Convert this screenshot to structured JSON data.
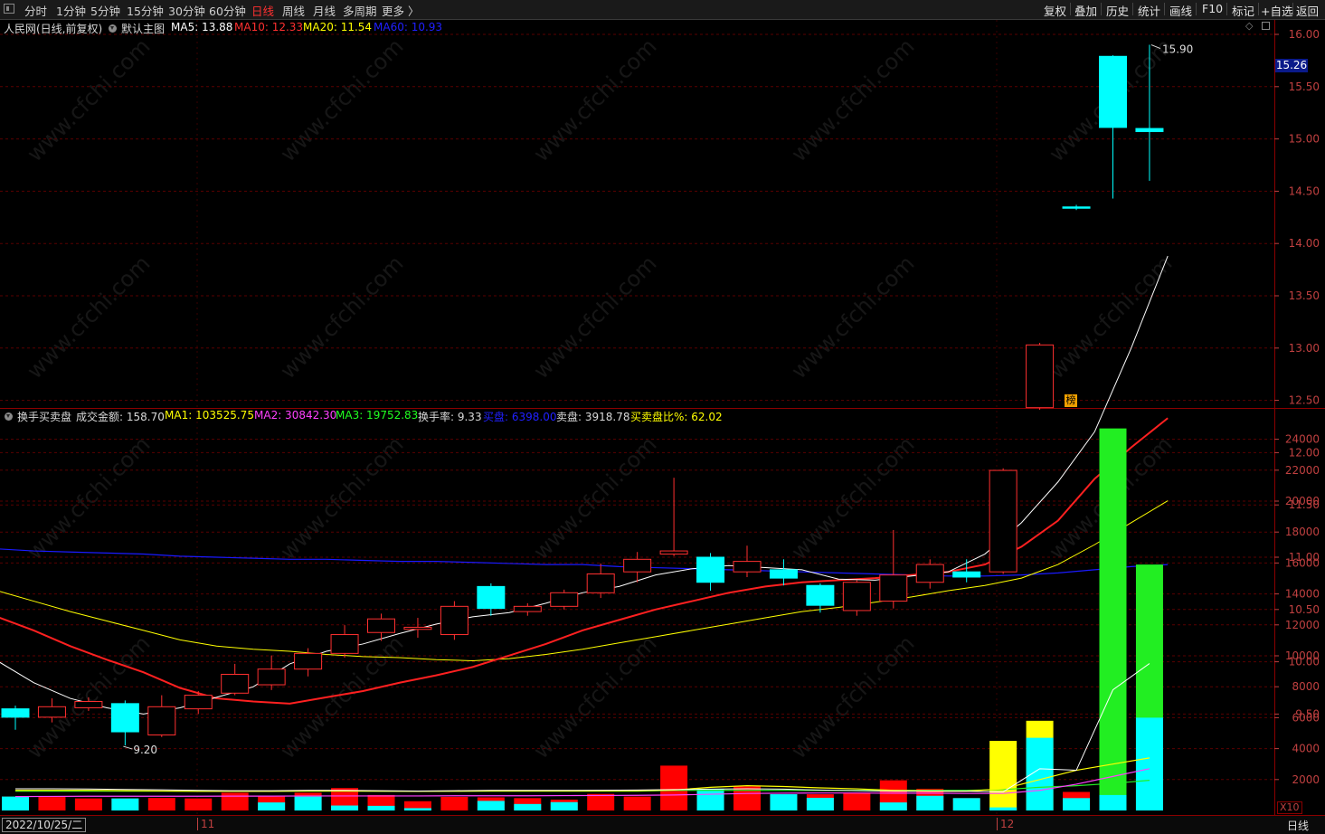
{
  "toolbar": {
    "periods": [
      "分时",
      "1分钟",
      "5分钟",
      "15分钟",
      "30分钟",
      "60分钟",
      "日线",
      "周线",
      "月线",
      "多周期",
      "更多 〉"
    ],
    "active_period": "日线",
    "right_buttons": [
      "复权",
      "叠加",
      "历史",
      "统计",
      "画线",
      "F10",
      "标记",
      "+自选",
      "返回"
    ]
  },
  "main_legend": {
    "title": "人民网(日线,前复权)",
    "indicator": "默认主图",
    "ma5": "MA5: 13.88",
    "ma10": "MA10: 12.33",
    "ma20": "MA20: 11.54",
    "ma60": "MA60: 10.93"
  },
  "sub_legend": {
    "title": "换手买卖盘",
    "amount": "成交金额: 158.70",
    "ma1": "MA1: 103525.75",
    "ma2": "MA2: 30842.30",
    "ma3": "MA3: 19752.83",
    "turnover": "换手率: 9.33",
    "buy": "买盘: 6398.00",
    "sell": "卖盘: 3918.78",
    "ratio": "买卖盘比%: 62.02"
  },
  "annotations": {
    "high": "15.90",
    "low": "9.20",
    "current_price": "15.26",
    "rank_badge": "榜",
    "volume_scale": "X10"
  },
  "bottom": {
    "start_date": "2022/10/25/二",
    "month_11": "11",
    "month_12": "12",
    "period_label": "日线"
  },
  "colors": {
    "up": "#ff3030",
    "down": "#00ffff",
    "ma5": "#ffffff",
    "ma10": "#ff2020",
    "ma20": "#ffff00",
    "ma60": "#1a1aff",
    "grid": "#5a0000",
    "axis_text": "#c04040"
  },
  "chart_data": [
    {
      "type": "candlestick",
      "title": "人民网(日线,前复权)",
      "yticks": [
        9.5,
        10.0,
        10.5,
        11.0,
        11.5,
        12.0,
        12.5,
        13.0,
        13.5,
        14.0,
        14.5,
        15.0,
        15.5,
        16.0
      ],
      "ylim": [
        9.0,
        16.2
      ],
      "candles": [
        {
          "o": 9.55,
          "c": 9.47,
          "h": 9.58,
          "l": 9.35
        },
        {
          "o": 9.47,
          "c": 9.57,
          "h": 9.65,
          "l": 9.42
        },
        {
          "o": 9.56,
          "c": 9.62,
          "h": 9.66,
          "l": 9.53
        },
        {
          "o": 9.6,
          "c": 9.33,
          "h": 9.63,
          "l": 9.2
        },
        {
          "o": 9.3,
          "c": 9.57,
          "h": 9.68,
          "l": 9.28
        },
        {
          "o": 9.55,
          "c": 9.68,
          "h": 9.72,
          "l": 9.5
        },
        {
          "o": 9.7,
          "c": 9.88,
          "h": 9.98,
          "l": 9.68
        },
        {
          "o": 9.78,
          "c": 9.93,
          "h": 10.06,
          "l": 9.73
        },
        {
          "o": 9.93,
          "c": 10.08,
          "h": 10.13,
          "l": 9.86
        },
        {
          "o": 10.08,
          "c": 10.26,
          "h": 10.35,
          "l": 10.04
        },
        {
          "o": 10.28,
          "c": 10.41,
          "h": 10.46,
          "l": 10.2
        },
        {
          "o": 10.31,
          "c": 10.33,
          "h": 10.42,
          "l": 10.23
        },
        {
          "o": 10.26,
          "c": 10.53,
          "h": 10.58,
          "l": 10.21
        },
        {
          "o": 10.72,
          "c": 10.51,
          "h": 10.75,
          "l": 10.44
        },
        {
          "o": 10.48,
          "c": 10.53,
          "h": 10.56,
          "l": 10.44
        },
        {
          "o": 10.53,
          "c": 10.66,
          "h": 10.69,
          "l": 10.5
        },
        {
          "o": 10.66,
          "c": 10.84,
          "h": 10.94,
          "l": 10.61
        },
        {
          "o": 10.86,
          "c": 10.98,
          "h": 11.05,
          "l": 10.76
        },
        {
          "o": 11.03,
          "c": 11.06,
          "h": 11.76,
          "l": 11.01
        },
        {
          "o": 11.0,
          "c": 10.76,
          "h": 11.04,
          "l": 10.68
        },
        {
          "o": 10.86,
          "c": 10.96,
          "h": 11.11,
          "l": 10.81
        },
        {
          "o": 10.88,
          "c": 10.8,
          "h": 10.98,
          "l": 10.73
        },
        {
          "o": 10.73,
          "c": 10.54,
          "h": 10.75,
          "l": 10.47
        },
        {
          "o": 10.49,
          "c": 10.76,
          "h": 10.78,
          "l": 10.44
        },
        {
          "o": 10.58,
          "c": 10.83,
          "h": 11.26,
          "l": 10.51
        },
        {
          "o": 10.76,
          "c": 10.93,
          "h": 10.98,
          "l": 10.7
        },
        {
          "o": 10.86,
          "c": 10.81,
          "h": 10.98,
          "l": 10.76
        },
        {
          "o": 10.86,
          "c": 11.83,
          "h": 11.85,
          "l": 10.84
        },
        {
          "o": 12.43,
          "c": 13.03,
          "h": 13.05,
          "l": 12.41
        },
        {
          "o": 14.35,
          "c": 14.34,
          "h": 14.37,
          "l": 14.32
        },
        {
          "o": 15.79,
          "c": 15.11,
          "h": 15.8,
          "l": 14.43
        },
        {
          "o": 15.1,
          "c": 15.07,
          "h": 15.9,
          "l": 14.6
        }
      ],
      "ma5": [
        10.01,
        9.8,
        9.65,
        9.56,
        9.5,
        9.56,
        9.66,
        9.76,
        9.98,
        10.1,
        10.17,
        10.27,
        10.36,
        10.43,
        10.47,
        10.56,
        10.66,
        10.72,
        10.83,
        10.89,
        10.92,
        10.9,
        10.88,
        10.79,
        10.78,
        10.82,
        10.86,
        11.03,
        11.33,
        11.72,
        12.2,
        13.0,
        13.88
      ],
      "ma10": [
        10.43,
        10.3,
        10.15,
        10.02,
        9.9,
        9.75,
        9.65,
        9.62,
        9.6,
        9.66,
        9.72,
        9.8,
        9.87,
        9.95,
        10.06,
        10.17,
        10.3,
        10.4,
        10.5,
        10.58,
        10.66,
        10.72,
        10.76,
        10.78,
        10.8,
        10.83,
        10.86,
        10.93,
        11.1,
        11.35,
        11.75,
        12.05,
        12.33
      ],
      "ma20": [
        10.68,
        10.58,
        10.48,
        10.39,
        10.3,
        10.21,
        10.15,
        10.12,
        10.1,
        10.07,
        10.05,
        10.04,
        10.02,
        10.01,
        10.03,
        10.07,
        10.12,
        10.18,
        10.24,
        10.3,
        10.36,
        10.42,
        10.48,
        10.52,
        10.57,
        10.62,
        10.68,
        10.73,
        10.8,
        10.93,
        11.12,
        11.33,
        11.54
      ],
      "ma60": [
        11.08,
        11.06,
        11.05,
        11.04,
        11.03,
        11.01,
        11.0,
        10.99,
        10.98,
        10.98,
        10.97,
        10.96,
        10.96,
        10.95,
        10.94,
        10.93,
        10.93,
        10.91,
        10.9,
        10.89,
        10.88,
        10.87,
        10.86,
        10.85,
        10.84,
        10.83,
        10.82,
        10.82,
        10.83,
        10.85,
        10.88,
        10.91,
        10.93
      ]
    },
    {
      "type": "bar",
      "title": "换手买卖盘",
      "yticks": [
        2000,
        4000,
        6000,
        8000,
        10000,
        12000,
        14000,
        16000,
        18000,
        20000,
        22000,
        24000
      ],
      "ylim": [
        0,
        25000
      ],
      "series": [
        {
          "name": "买盘",
          "values": [
            900,
            870,
            780,
            780,
            810,
            780,
            1150,
            520,
            900,
            320,
            300,
            150,
            880,
            620,
            420,
            540,
            1070,
            900,
            2900,
            1400,
            1550,
            1050,
            820,
            1150,
            520,
            950,
            800,
            200,
            4700,
            800,
            1000,
            6000
          ]
        },
        {
          "name": "卖盘",
          "values": [
            900,
            870,
            780,
            780,
            810,
            780,
            1150,
            900,
            1150,
            1450,
            1000,
            600,
            880,
            850,
            800,
            700,
            1070,
            900,
            2900,
            1400,
            1550,
            1050,
            1050,
            1150,
            1950,
            1400,
            800,
            4500,
            5800,
            1200,
            24700,
            15900
          ]
        }
      ],
      "ma_lines": {
        "white": [
          1400,
          1400,
          1390,
          1360,
          1340,
          1300,
          1280,
          1280,
          1300,
          1300,
          1280,
          1260,
          1280,
          1300,
          1300,
          1300,
          1310,
          1320,
          1350,
          1380,
          1400,
          1380,
          1320,
          1280,
          1240,
          1240,
          1240,
          1200,
          2700,
          2600,
          7800,
          9500
        ],
        "yellow": [
          1300,
          1300,
          1300,
          1280,
          1260,
          1240,
          1240,
          1240,
          1260,
          1260,
          1250,
          1240,
          1250,
          1260,
          1260,
          1260,
          1270,
          1280,
          1320,
          1500,
          1600,
          1550,
          1460,
          1400,
          1300,
          1250,
          1250,
          1400,
          2000,
          2600,
          3000,
          3400
        ],
        "magenta": [
          900,
          910,
          920,
          920,
          920,
          920,
          930,
          930,
          940,
          940,
          940,
          940,
          950,
          950,
          950,
          960,
          970,
          980,
          1000,
          1050,
          1100,
          1120,
          1130,
          1130,
          1120,
          1120,
          1100,
          1100,
          1300,
          1700,
          2200,
          2700
        ],
        "green": [
          1250,
          1250,
          1250,
          1250,
          1250,
          1250,
          1250,
          1250,
          1250,
          1250,
          1250,
          1250,
          1250,
          1250,
          1250,
          1250,
          1250,
          1250,
          1300,
          1300,
          1300,
          1300,
          1300,
          1300,
          1300,
          1300,
          1300,
          1350,
          1500,
          1600,
          1750,
          1950
        ]
      }
    }
  ]
}
